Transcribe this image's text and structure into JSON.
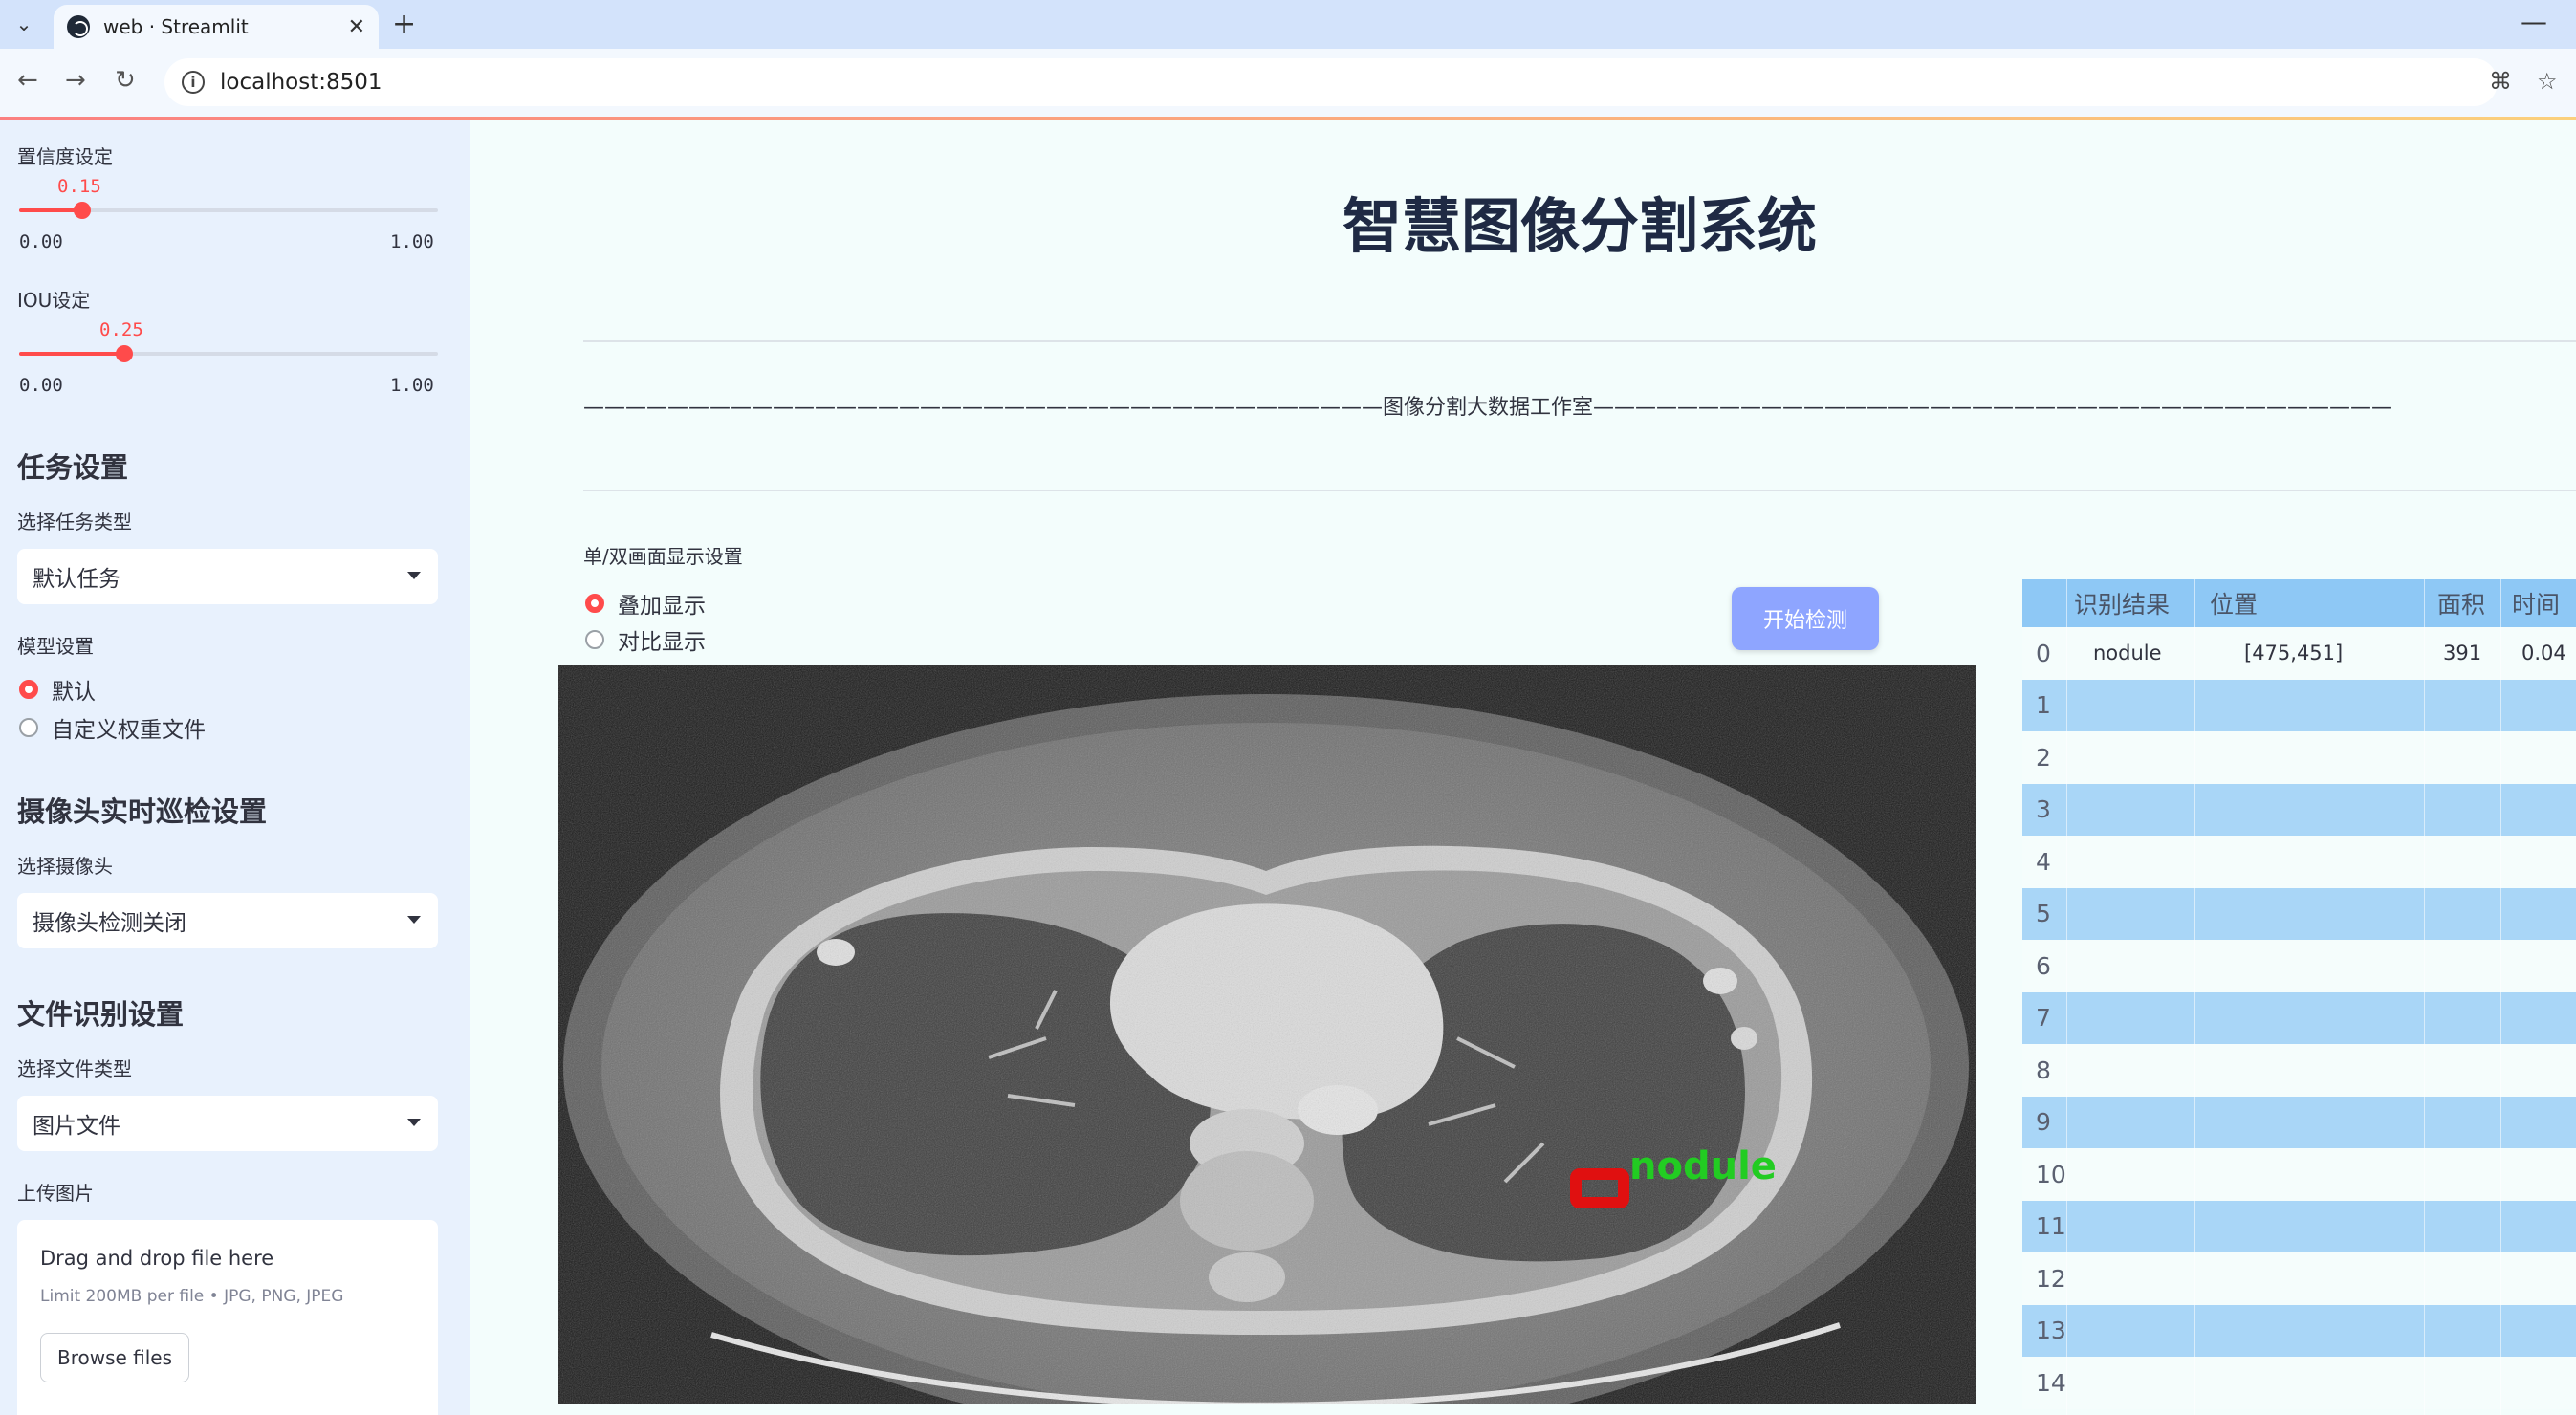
{
  "browser": {
    "tab_title": "web · Streamlit",
    "url": "localhost:8501"
  },
  "sidebar": {
    "confidence": {
      "label": "置信度设定",
      "value": "0.15",
      "min": "0.00",
      "max": "1.00",
      "fraction": 0.15
    },
    "iou": {
      "label": "IOU设定",
      "value": "0.25",
      "min": "0.00",
      "max": "1.00",
      "fraction": 0.25
    },
    "task": {
      "heading": "任务设置",
      "select_label": "选择任务类型",
      "selected": "默认任务"
    },
    "model": {
      "label": "模型设置",
      "options": [
        "默认",
        "自定义权重文件"
      ],
      "selected_index": 0
    },
    "camera": {
      "heading": "摄像头实时巡检设置",
      "select_label": "选择摄像头",
      "selected": "摄像头检测关闭"
    },
    "file": {
      "heading": "文件识别设置",
      "select_label": "选择文件类型",
      "selected": "图片文件",
      "upload_label": "上传图片"
    },
    "uploader": {
      "drag_text": "Drag and drop file here",
      "limit_text": "Limit 200MB per file • JPG, PNG, JPEG",
      "browse_label": "Browse files"
    }
  },
  "main": {
    "title": "智慧图像分割系统",
    "studio_line": "——————————————————————————————————————图像分割大数据工作室——————————————————————————————————————",
    "display": {
      "label": "单/双画面显示设置",
      "options": [
        "叠加显示",
        "对比显示"
      ],
      "selected_index": 0
    },
    "start_button": "开始检测",
    "detection_label": "nodule",
    "colors": {
      "accent": "#ff4b4b",
      "button": "#8ea5ff",
      "table_header": "#8ec8f5",
      "table_band": "#a9d6f7",
      "box": "#e01010",
      "label_text": "#22cc22"
    }
  },
  "table": {
    "columns": [
      "识别结果",
      "位置",
      "面积",
      "时间"
    ],
    "rows": [
      {
        "index": "0",
        "result": "nodule",
        "position": "[475,451]",
        "area": "391",
        "time": "0.04"
      },
      {
        "index": "1",
        "result": "",
        "position": "",
        "area": "",
        "time": ""
      },
      {
        "index": "2",
        "result": "",
        "position": "",
        "area": "",
        "time": ""
      },
      {
        "index": "3",
        "result": "",
        "position": "",
        "area": "",
        "time": ""
      },
      {
        "index": "4",
        "result": "",
        "position": "",
        "area": "",
        "time": ""
      },
      {
        "index": "5",
        "result": "",
        "position": "",
        "area": "",
        "time": ""
      },
      {
        "index": "6",
        "result": "",
        "position": "",
        "area": "",
        "time": ""
      },
      {
        "index": "7",
        "result": "",
        "position": "",
        "area": "",
        "time": ""
      },
      {
        "index": "8",
        "result": "",
        "position": "",
        "area": "",
        "time": ""
      },
      {
        "index": "9",
        "result": "",
        "position": "",
        "area": "",
        "time": ""
      },
      {
        "index": "10",
        "result": "",
        "position": "",
        "area": "",
        "time": ""
      },
      {
        "index": "11",
        "result": "",
        "position": "",
        "area": "",
        "time": ""
      },
      {
        "index": "12",
        "result": "",
        "position": "",
        "area": "",
        "time": ""
      },
      {
        "index": "13",
        "result": "",
        "position": "",
        "area": "",
        "time": ""
      },
      {
        "index": "14",
        "result": "",
        "position": "",
        "area": "",
        "time": ""
      }
    ]
  }
}
